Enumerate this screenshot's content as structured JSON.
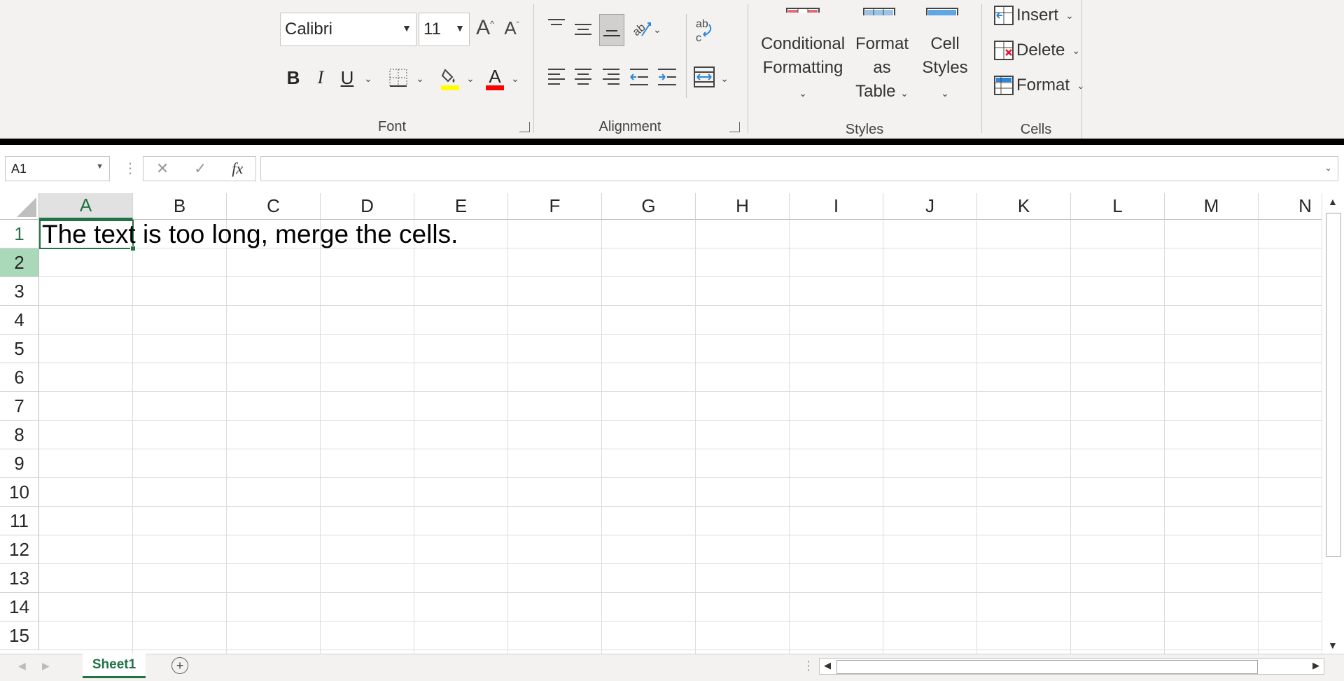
{
  "ribbon": {
    "font": {
      "font_name": "Calibri",
      "font_size": "11",
      "group_label": "Font",
      "bold": "B",
      "italic": "I",
      "underline": "U",
      "font_color_glyph": "A",
      "fill_highlight": "#ffff00",
      "font_color": "#ff0000"
    },
    "alignment": {
      "group_label": "Alignment"
    },
    "styles": {
      "group_label": "Styles",
      "conditional_formatting": [
        "Conditional",
        "Formatting"
      ],
      "format_as_table": [
        "Format as",
        "Table"
      ],
      "cell_styles": [
        "Cell",
        "Styles"
      ]
    },
    "cells": {
      "group_label": "Cells",
      "insert": "Insert",
      "delete": "Delete",
      "format": "Format"
    }
  },
  "formula_bar": {
    "name_box": "A1",
    "fx": "fx",
    "value": ""
  },
  "grid": {
    "columns": [
      "A",
      "B",
      "C",
      "D",
      "E",
      "F",
      "G",
      "H",
      "I",
      "J",
      "K",
      "L",
      "M",
      "N"
    ],
    "rows": [
      "1",
      "2",
      "3",
      "4",
      "5",
      "6",
      "7",
      "8",
      "9",
      "10",
      "11",
      "12",
      "13",
      "14",
      "15"
    ],
    "selected_cell": "A1",
    "cell_A1": "The text is too long, merge the cells."
  },
  "sheets": {
    "tabs": [
      "Sheet1"
    ],
    "active": "Sheet1"
  },
  "colors": {
    "accent": "#217346",
    "row_highlight": "#a9d9b9"
  }
}
